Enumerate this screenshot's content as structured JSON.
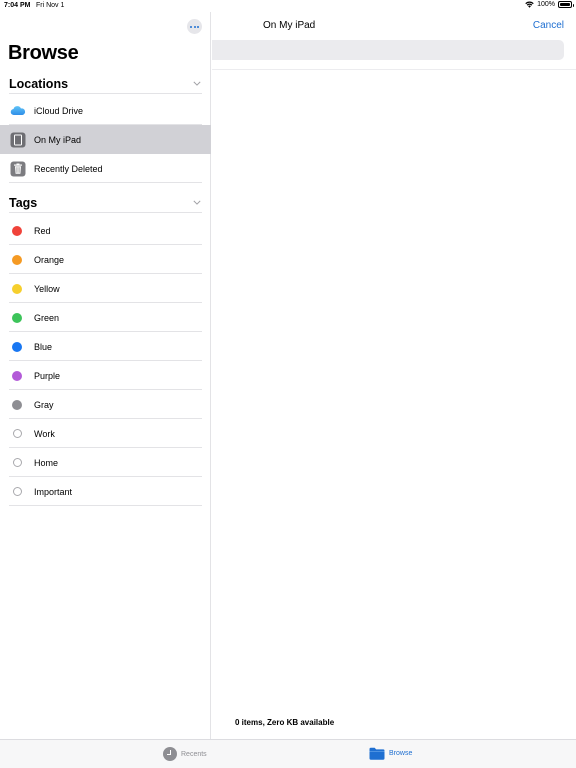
{
  "status_bar": {
    "time": "7:04 PM",
    "date": "Fri Nov 1",
    "battery": "100%"
  },
  "sidebar": {
    "title": "Browse",
    "locations": {
      "header": "Locations",
      "items": [
        {
          "label": "iCloud Drive",
          "icon": "icloud-icon",
          "selected": false
        },
        {
          "label": "On My iPad",
          "icon": "ipad-icon",
          "selected": true
        },
        {
          "label": "Recently Deleted",
          "icon": "trash-icon",
          "selected": false
        }
      ]
    },
    "tags": {
      "header": "Tags",
      "items": [
        {
          "label": "Red",
          "color": "#f0433a"
        },
        {
          "label": "Orange",
          "color": "#f59a23"
        },
        {
          "label": "Yellow",
          "color": "#f6cf2d"
        },
        {
          "label": "Green",
          "color": "#3dc45a"
        },
        {
          "label": "Blue",
          "color": "#1877f2"
        },
        {
          "label": "Purple",
          "color": "#b35ad8"
        },
        {
          "label": "Gray",
          "color": "#8e8e93"
        },
        {
          "label": "Work",
          "color": ""
        },
        {
          "label": "Home",
          "color": ""
        },
        {
          "label": "Important",
          "color": ""
        }
      ]
    }
  },
  "main": {
    "title": "On My iPad",
    "cancel_label": "Cancel",
    "storage_info": "0 items, Zero KB available"
  },
  "tab_bar": {
    "recents_label": "Recents",
    "browse_label": "Browse"
  },
  "colors": {
    "accent": "#1f6fd1",
    "selected_row": "#d1d1d6"
  }
}
